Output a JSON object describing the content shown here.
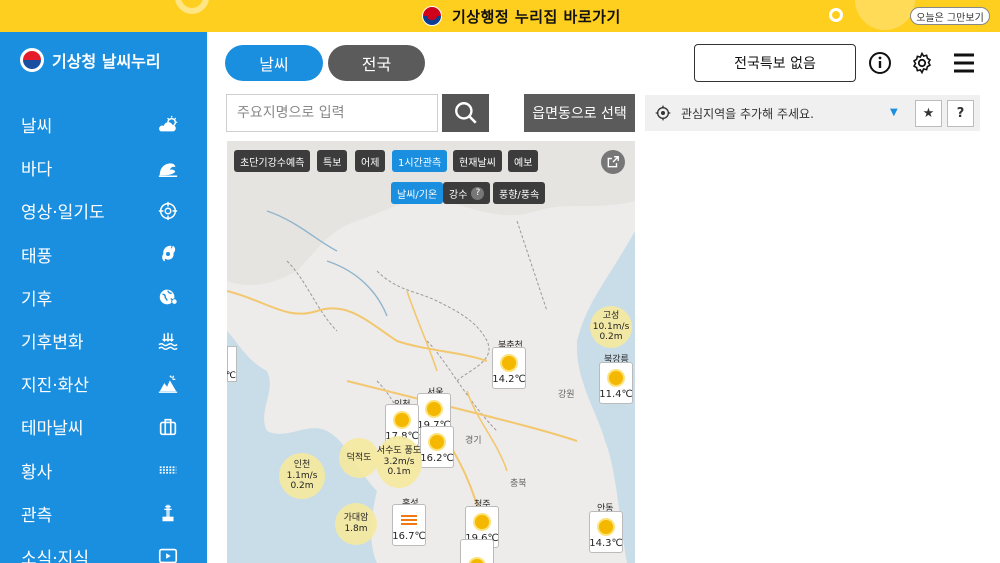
{
  "banner": {
    "link_text": "기상행정 누리집 바로가기",
    "close_today": "오늘은 그만보기"
  },
  "logo": {
    "text": "기상청 날씨누리"
  },
  "sidebar": {
    "items": [
      {
        "label": "날씨",
        "icon": "weather-icon"
      },
      {
        "label": "바다",
        "icon": "wave-icon"
      },
      {
        "label": "영상·일기도",
        "icon": "satellite-icon"
      },
      {
        "label": "태풍",
        "icon": "typhoon-icon"
      },
      {
        "label": "기후",
        "icon": "globe-icon"
      },
      {
        "label": "기후변화",
        "icon": "climate-change-icon"
      },
      {
        "label": "지진·화산",
        "icon": "earthquake-icon"
      },
      {
        "label": "테마날씨",
        "icon": "suitcase-icon"
      },
      {
        "label": "황사",
        "icon": "dust-icon"
      },
      {
        "label": "관측",
        "icon": "observation-icon"
      },
      {
        "label": "소식·지식",
        "icon": "video-icon"
      }
    ]
  },
  "header": {
    "tab_weather": "날씨",
    "tab_nation": "전국",
    "warning_button": "전국특보 없음"
  },
  "search": {
    "placeholder": "주요지명으로 입력",
    "dong_button": "읍면동으로 선택"
  },
  "favorites": {
    "text": "관심지역을 추가해 주세요.",
    "star": "★",
    "help": "?"
  },
  "map": {
    "tabs": [
      {
        "label": "초단기강수예측",
        "active": false
      },
      {
        "label": "특보",
        "active": false
      },
      {
        "label": "어제",
        "active": false
      },
      {
        "label": "1시간관측",
        "active": true
      },
      {
        "label": "현재날씨",
        "active": false
      },
      {
        "label": "예보",
        "active": false
      }
    ],
    "subtabs": [
      {
        "label": "날씨/기온",
        "active": true
      },
      {
        "label": "강수",
        "active": false,
        "help": "?"
      },
      {
        "label": "풍향/풍속",
        "active": false
      }
    ],
    "stations": [
      {
        "name": "북춘천",
        "temp": "14.2℃",
        "icon": "sun"
      },
      {
        "name": "북강릉",
        "temp": "11.4℃",
        "icon": "sun"
      },
      {
        "name": "서울",
        "temp": "19.7℃",
        "icon": "sun"
      },
      {
        "name": "인천",
        "temp": "17.8℃",
        "icon": "sun"
      },
      {
        "name": "",
        "temp": "16.2℃",
        "icon": "sun"
      },
      {
        "name": "홍성",
        "temp": "16.7℃",
        "icon": "haze"
      },
      {
        "name": "청주",
        "temp": "19.6℃",
        "icon": "sun"
      },
      {
        "name": "안동",
        "temp": "14.3℃",
        "icon": "sun"
      },
      {
        "name": "",
        "temp": "",
        "icon": "sun"
      }
    ],
    "sea_buoys": [
      {
        "name": "고성",
        "wind": "10.1m/s",
        "wave": "0.2m"
      },
      {
        "name": "인천",
        "wind": "1.1m/s",
        "wave": "0.2m"
      },
      {
        "name": "덕적도",
        "wind": "",
        "wave": ""
      },
      {
        "name": "서수도 풍도",
        "wind": "3.2m/s",
        "wave": "0.1m"
      },
      {
        "name": "가대암",
        "wind": "",
        "wave": "1.8m"
      }
    ],
    "map_labels": [
      "강원",
      "경기",
      "충북"
    ],
    "left_edge_unit": "℃"
  },
  "colors": {
    "brand_blue": "#1a8fe0",
    "banner_yellow": "#ffcf1f",
    "dark_button": "#5b5b5b"
  }
}
